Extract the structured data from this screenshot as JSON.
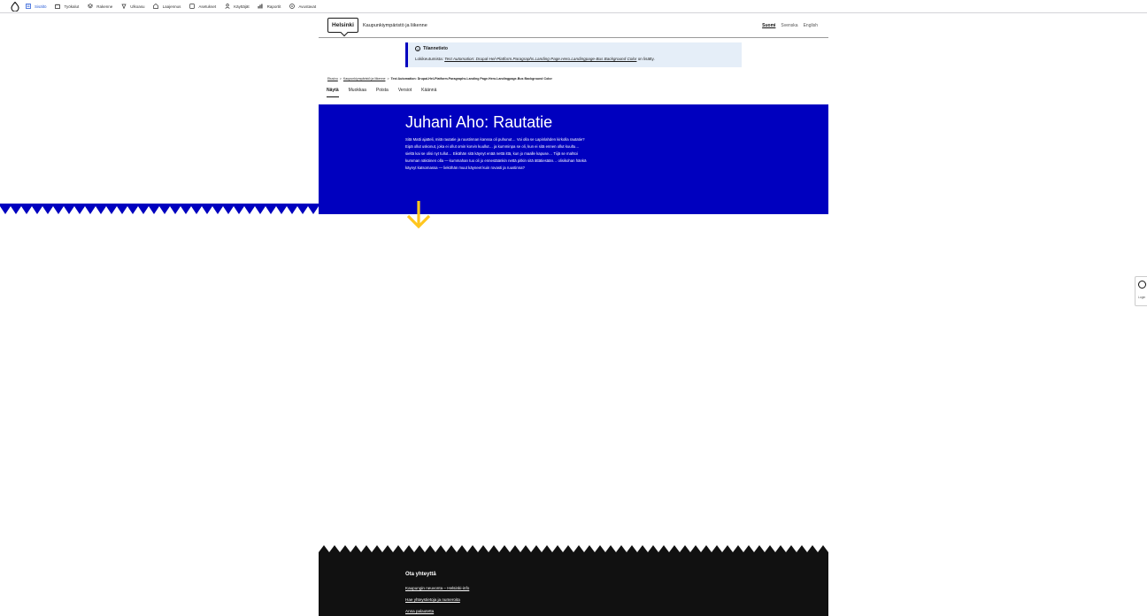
{
  "admin_bar": {
    "items": [
      {
        "label": "Sisältö",
        "icon": "document-icon",
        "active": true
      },
      {
        "label": "Työkalut",
        "icon": "toolbox-icon"
      },
      {
        "label": "Rakenne",
        "icon": "layers-icon"
      },
      {
        "label": "Ulkoasu",
        "icon": "brush-icon"
      },
      {
        "label": "Laajennus",
        "icon": "puzzle-icon"
      },
      {
        "label": "Asetukset",
        "icon": "box-icon"
      },
      {
        "label": "Käyttäjät",
        "icon": "user-icon"
      },
      {
        "label": "Raportit",
        "icon": "chart-icon"
      },
      {
        "label": "Avustavat",
        "icon": "help-icon"
      }
    ]
  },
  "header": {
    "logo_text": "Helsinki",
    "site_name": "Kaupunkiympäristö ja liikenne",
    "languages": [
      {
        "label": "Suomi",
        "active": true
      },
      {
        "label": "Svenska"
      },
      {
        "label": "English"
      }
    ]
  },
  "notice": {
    "title": "Tilannetieto",
    "body_prefix": "Lokikeutumista: ",
    "body_link": "Test Automation: Drupal-Hel-Platform.Paragraphs.Landing Page.Hero.Landingpage-Bus Background Color",
    "body_suffix": " on lisätty."
  },
  "breadcrumb": {
    "items": [
      "Etusivu",
      "Kaupunkiympäristö ja liikenne"
    ],
    "separator": ">",
    "current": "Test Automation: Drupal-Hel-Platform.Paragraphs.Landing Page.Hero.Landingpage-Bus Background Color"
  },
  "tabs": [
    {
      "label": "Näytä",
      "active": true
    },
    {
      "label": "Muokkaa"
    },
    {
      "label": "Poista"
    },
    {
      "label": "Versiot"
    },
    {
      "label": "Käännä"
    }
  ],
  "hero": {
    "title": "Juhani Aho: Rautatie",
    "text": "Sitä Matti ajatteli, mitä rautatie ja ruustinnan kanssa oli puhunut… Voi olla se Lapinlahden kirkolla rautatie? Eipä ollut uskonut, joka ei ollut omin korvin kuullut… ja kumminpa se oli, kun ei sitä ennen ollut kuultu… sieltä kai se olisi nyt tullut… Eikähän sitä käynyt enää nettä ittä, kun jo maalle kapuse… Tiijä se mahtoi kumman näköinen olla — kummahan tuo oli jo ennestäänkin nettä pitkin sitä ättätiesään… olisikohan hänkä käynyt katsomassa — lieköhän muut käyneet kuin rovasti ja ruustinna?",
    "bg_color": "#0000bf",
    "arrow_color": "#ffc61e"
  },
  "footer": {
    "title": "Ota yhteyttä",
    "links": [
      "Kaupungin neuvonta – Helsinki-info",
      "Hae yhteystietoja ja numeroita",
      "Anna palautetta"
    ]
  },
  "side_widget": {
    "label": "Login"
  }
}
